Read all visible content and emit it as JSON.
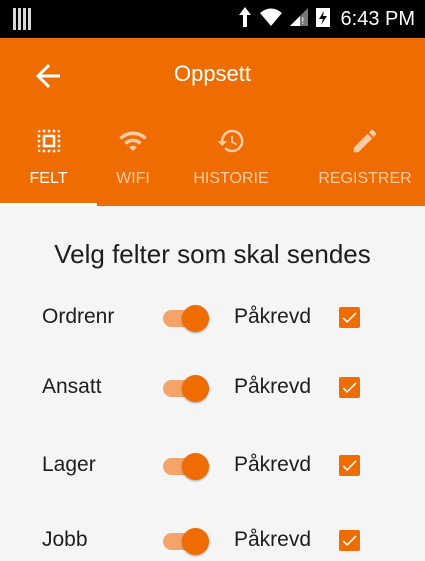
{
  "status_bar": {
    "time": "6:43 PM"
  },
  "header": {
    "title": "Oppsett"
  },
  "tabs": [
    {
      "label": "FELT",
      "icon": "select-area-icon",
      "active": true
    },
    {
      "label": "WIFI",
      "icon": "wifi-icon",
      "active": false
    },
    {
      "label": "HISTORIE",
      "icon": "history-icon",
      "active": false
    },
    {
      "label": "REGISTRER",
      "icon": "pencil-icon",
      "active": false
    }
  ],
  "main": {
    "heading": "Velg felter som skal sendes",
    "fields": [
      {
        "name": "Ordrenr",
        "enabled": true,
        "required_label": "Påkrevd",
        "required": true
      },
      {
        "name": "Ansatt",
        "enabled": true,
        "required_label": "Påkrevd",
        "required": true
      },
      {
        "name": "Lager",
        "enabled": true,
        "required_label": "Påkrevd",
        "required": true
      },
      {
        "name": "Jobb",
        "enabled": true,
        "required_label": "Påkrevd",
        "required": true
      }
    ]
  },
  "colors": {
    "accent": "#ef6c00",
    "switch_track": "#f4a46b",
    "status_bar": "#000000",
    "background": "#f5f5f5"
  }
}
